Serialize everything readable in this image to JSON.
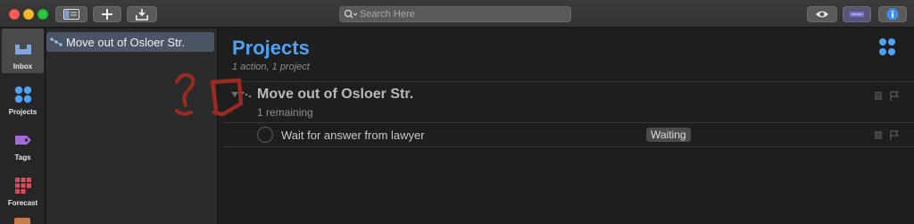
{
  "toolbar": {
    "search_placeholder": "Search Here"
  },
  "rail": {
    "items": [
      {
        "label": "Inbox"
      },
      {
        "label": "Projects"
      },
      {
        "label": "Tags"
      },
      {
        "label": "Forecast"
      }
    ]
  },
  "sidebar": {
    "items": [
      {
        "label": "Move out of Osloer Str."
      }
    ]
  },
  "main": {
    "title": "Projects",
    "subtitle": "1 action, 1 project",
    "project": {
      "title": "Move out of Osloer Str.",
      "remaining": "1 remaining",
      "actions": [
        {
          "title": "Wait for answer from lawyer",
          "tag": "Waiting"
        }
      ]
    }
  },
  "colors": {
    "accent": "#4fa3f7",
    "selection": "#4b5566",
    "annotation": "#9b2a22"
  }
}
